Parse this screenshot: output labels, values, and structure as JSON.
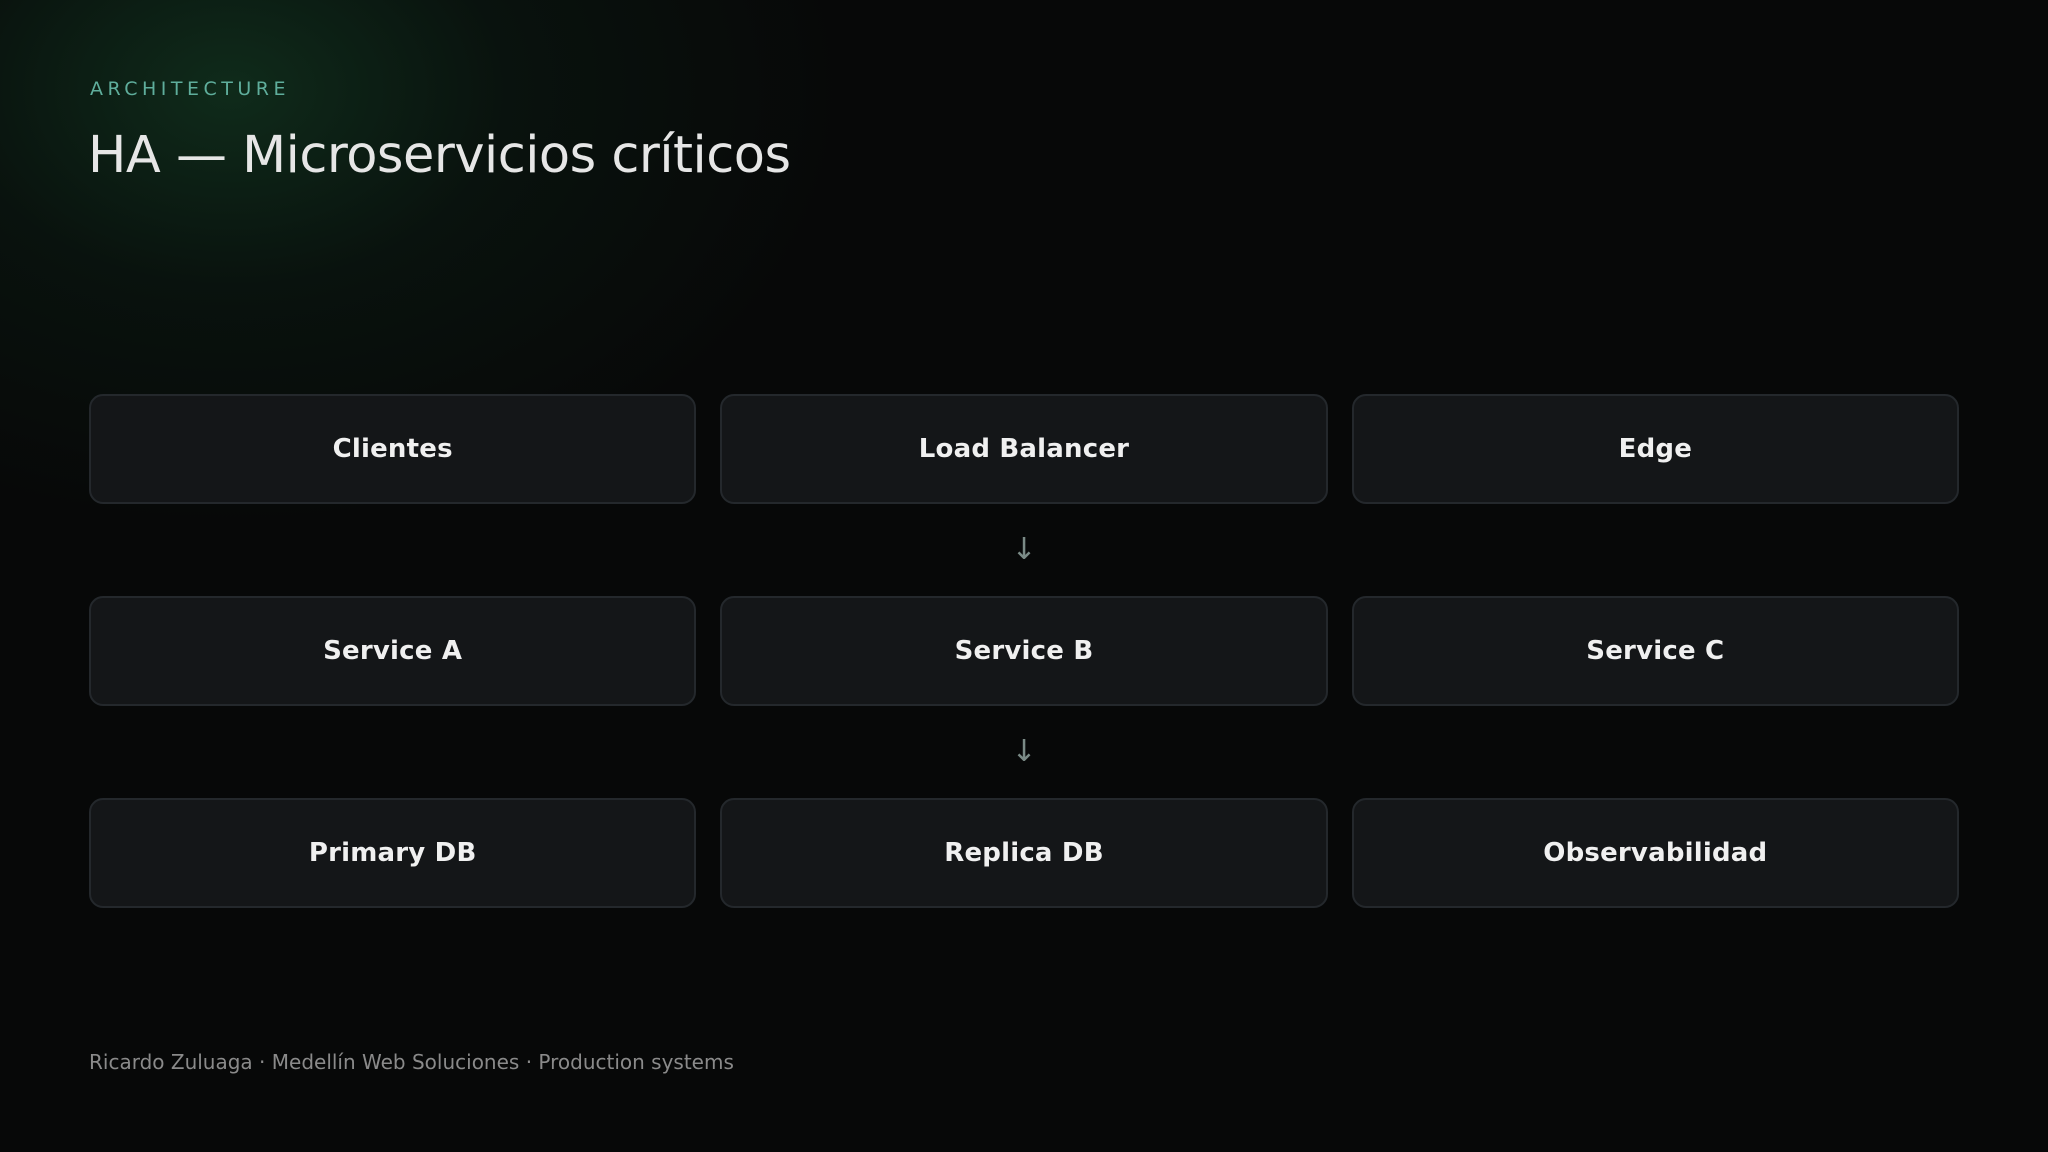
{
  "header": {
    "eyebrow": "ARCHITECTURE",
    "title": "HA — Microservicios críticos"
  },
  "diagram": {
    "rows": [
      [
        "Clientes",
        "Load Balancer",
        "Edge"
      ],
      [
        "Service A",
        "Service B",
        "Service C"
      ],
      [
        "Primary DB",
        "Replica DB",
        "Observabilidad"
      ]
    ],
    "arrow_glyph": "↓"
  },
  "footer": {
    "text": "Ricardo Zuluaga · Medellín Web Soluciones · Production systems"
  },
  "colors": {
    "accent": "#5fae9c",
    "background": "#070808",
    "box_fill": "#141618",
    "box_border": "#24282c"
  }
}
